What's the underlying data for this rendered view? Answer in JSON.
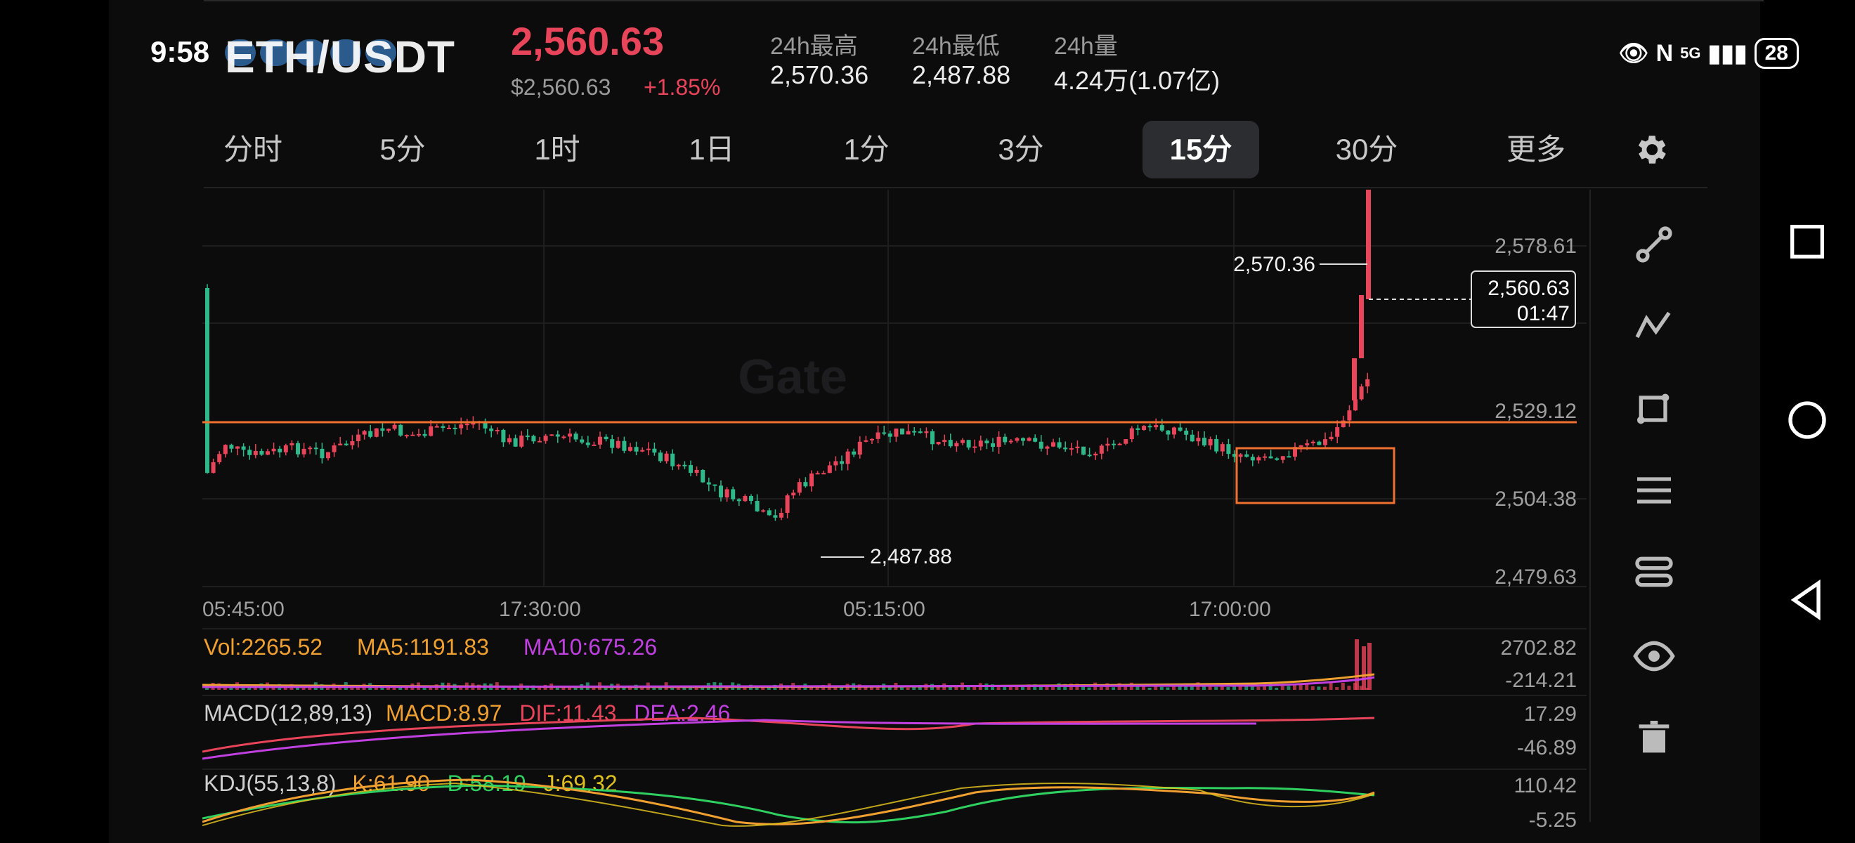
{
  "status_bar": {
    "time": "9:58",
    "battery": "28",
    "network": "5G"
  },
  "header": {
    "pair": "ETH/USDT",
    "price": "2,560.63",
    "price_usd": "$2,560.63",
    "change": "+1.85%",
    "stats": [
      {
        "label": "24h最高",
        "value": "2,570.36"
      },
      {
        "label": "24h最低",
        "value": "2,487.88"
      },
      {
        "label": "24h量",
        "value": "4.24万(1.07亿)"
      }
    ]
  },
  "tabs": [
    "分时",
    "5分",
    "1时",
    "1日",
    "1分",
    "3分",
    "15分",
    "30分",
    "更多"
  ],
  "active_tab": "15分",
  "chart": {
    "watermark": "Gate",
    "y_ticks": [
      "2,578.61",
      "2,529.12",
      "2,504.38",
      "2,479.63"
    ],
    "x_ticks": [
      "05:45:00",
      "17:30:00",
      "05:15:00",
      "17:00:00"
    ],
    "high_marker": "2,570.36",
    "low_marker": "2,487.88",
    "current_price_box": {
      "price": "2,560.63",
      "countdown": "01:47"
    },
    "vol_legend": {
      "vol": "Vol:2265.52",
      "ma5": "MA5:1191.83",
      "ma10": "MA10:675.26"
    },
    "vol_axis": [
      "2702.82",
      "-214.21"
    ],
    "macd_legend": {
      "name": "MACD(12,89,13)",
      "macd": "MACD:8.97",
      "dif": "DIF:11.43",
      "dea": "DEA:2.46"
    },
    "macd_axis": [
      "17.29",
      "-46.89"
    ],
    "kdj_legend": {
      "name": "KDJ(55,13,8)",
      "k": "K:61.90",
      "d": "D:58.19",
      "j": "J:69.32"
    },
    "kdj_axis": [
      "110.42",
      "-5.25"
    ]
  },
  "colors": {
    "up": "#e8445a",
    "down": "#2fb98a",
    "ma5": "#f0a030",
    "ma10": "#c040e0",
    "resistance": "#f07030"
  }
}
